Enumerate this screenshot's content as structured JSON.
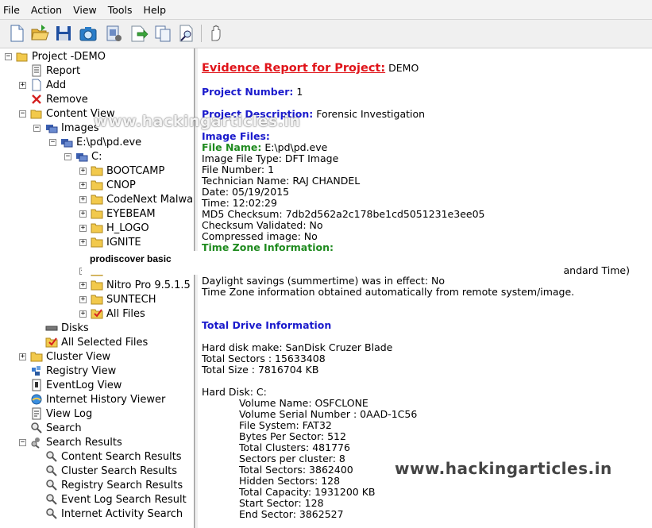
{
  "menu": [
    "File",
    "Action",
    "View",
    "Tools",
    "Help"
  ],
  "toolbar_icons": [
    "new-document-icon",
    "open-folder-icon",
    "save-disk-icon",
    "capture-image-icon",
    "add-image-icon",
    "export-icon",
    "copy-icon",
    "search-page-icon",
    "stop-hand-icon"
  ],
  "tree": {
    "project": "Project -DEMO",
    "report": "Report",
    "add": "Add",
    "remove": "Remove",
    "content_view": "Content View",
    "images": "Images",
    "image_file": "E:\\pd\\pd.eve",
    "drive": "C:",
    "folders": [
      "BOOTCAMP",
      "CNOP",
      "CodeNext Malwa",
      "EYEBEAM",
      "H_LOGO",
      "IGNITE",
      "",
      "",
      "Nitro Pro 9.5.1.5",
      "SUNTECH"
    ],
    "all_files": "All Files",
    "disks": "Disks",
    "all_selected": "All Selected Files",
    "cluster_view": "Cluster View",
    "registry_view": "Registry View",
    "eventlog_view": "EventLog View",
    "internet_history": "Internet History Viewer",
    "view_log": "View Log",
    "search": "Search",
    "search_results": "Search Results",
    "results": [
      "Content Search Results",
      "Cluster Search Results",
      "Registry Search Results",
      "Event Log Search Result",
      "Internet Activity Search"
    ]
  },
  "popup": {
    "title": "prodiscover basic",
    "right_text": "andard Time)"
  },
  "watermark": {
    "top": "www.hackingarticles.in",
    "bottom": "www.hackingarticles.in"
  },
  "report": {
    "title_label": "Evidence Report for Project:",
    "title_value": " DEMO",
    "project_number_label": "Project Number:",
    "project_number_value": " 1",
    "project_desc_label": "Project Description:",
    "project_desc_value": " Forensic Investigation",
    "image_files_label": "Image Files:",
    "file_name_label": "File Name:",
    "file_name_value": " E:\\pd\\pd.eve",
    "image_lines": [
      "Image File Type: DFT Image",
      "File Number: 1",
      "Technician Name: RAJ CHANDEL",
      "Date: 05/19/2015",
      "Time: 12:02:29",
      "MD5 Checksum: 7db2d562a2c178be1cd5051231e3ee05",
      "Checksum Validated: No",
      "Compressed image: No"
    ],
    "tz_label": "Time Zone Information:",
    "tz_lines": [
      "Daylight savings (summertime) was in effect: No",
      "Time Zone information obtained automatically from remote system/image."
    ],
    "total_drive_label": "Total Drive Information",
    "drive_lines": [
      "Hard disk make: SanDisk  Cruzer Blade",
      "Total Sectors : 15633408",
      "Total Size : 7816704 KB"
    ],
    "hard_disk_line": "Hard Disk: C:",
    "volume_lines": [
      "Volume Name:  OSFCLONE",
      "Volume Serial Number : 0AAD-1C56",
      "File System: FAT32",
      "Bytes Per Sector: 512",
      "Total Clusters: 481776",
      "Sectors per cluster: 8",
      "Total Sectors: 3862400",
      "Hidden Sectors: 128",
      "Total Capacity: 1931200 KB",
      "Start Sector: 128",
      "End Sector: 3862527"
    ]
  }
}
